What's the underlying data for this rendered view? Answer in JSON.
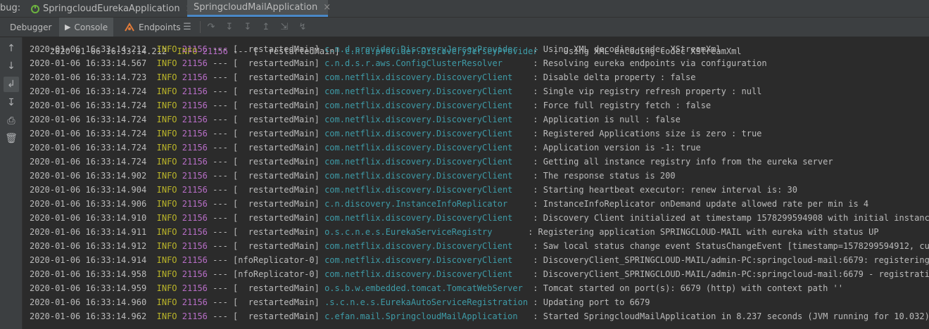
{
  "tabbar": {
    "label": "bug:",
    "tabs": [
      {
        "label": "SpringcloudEurekaApplication",
        "close": "×",
        "active": false
      },
      {
        "label": "SpringcloudMailApplication",
        "close": "×",
        "active": true
      }
    ]
  },
  "toolbar": {
    "items": [
      {
        "label": "Debugger",
        "icon": ""
      },
      {
        "label": "Console",
        "icon": "console-icon"
      },
      {
        "label": "Endpoints",
        "icon": "endpoints-icon"
      }
    ]
  },
  "colors": {
    "background": "#2b2b2b",
    "timestamp": "#bbbbbb",
    "level": "#bbb529",
    "pid": "#b86ec7",
    "logger": "#3e9ba7",
    "active_tab_underline": "#4a88c7"
  },
  "console": {
    "partial_top_line": {
      "timestamp": "2020-01-06 16:33:14.212",
      "level": "INFO",
      "pid": "21156",
      "sep": "--- [",
      "thread": "  restartedMain]",
      "logger": "c.n.d.provider.DiscoveryJerseyProvider",
      "message": ": Using XML encoding codec XStreamXml"
    },
    "lines": [
      {
        "timestamp": "2020-01-06 16:33:14.212",
        "level": "INFO",
        "pid": "21156",
        "sep": "--- [",
        "thread": "  restartedMain]",
        "logger": "c.n.d.provider.DiscoveryJerseyProvider  ",
        "message": ": Using XML decoding codec XStreamXml"
      },
      {
        "timestamp": "2020-01-06 16:33:14.567",
        "level": "INFO",
        "pid": "21156",
        "sep": "--- [",
        "thread": "  restartedMain]",
        "logger": "c.n.d.s.r.aws.ConfigClusterResolver     ",
        "message": ": Resolving eureka endpoints via configuration"
      },
      {
        "timestamp": "2020-01-06 16:33:14.723",
        "level": "INFO",
        "pid": "21156",
        "sep": "--- [",
        "thread": "  restartedMain]",
        "logger": "com.netflix.discovery.DiscoveryClient   ",
        "message": ": Disable delta property : false"
      },
      {
        "timestamp": "2020-01-06 16:33:14.724",
        "level": "INFO",
        "pid": "21156",
        "sep": "--- [",
        "thread": "  restartedMain]",
        "logger": "com.netflix.discovery.DiscoveryClient   ",
        "message": ": Single vip registry refresh property : null"
      },
      {
        "timestamp": "2020-01-06 16:33:14.724",
        "level": "INFO",
        "pid": "21156",
        "sep": "--- [",
        "thread": "  restartedMain]",
        "logger": "com.netflix.discovery.DiscoveryClient   ",
        "message": ": Force full registry fetch : false"
      },
      {
        "timestamp": "2020-01-06 16:33:14.724",
        "level": "INFO",
        "pid": "21156",
        "sep": "--- [",
        "thread": "  restartedMain]",
        "logger": "com.netflix.discovery.DiscoveryClient   ",
        "message": ": Application is null : false"
      },
      {
        "timestamp": "2020-01-06 16:33:14.724",
        "level": "INFO",
        "pid": "21156",
        "sep": "--- [",
        "thread": "  restartedMain]",
        "logger": "com.netflix.discovery.DiscoveryClient   ",
        "message": ": Registered Applications size is zero : true"
      },
      {
        "timestamp": "2020-01-06 16:33:14.724",
        "level": "INFO",
        "pid": "21156",
        "sep": "--- [",
        "thread": "  restartedMain]",
        "logger": "com.netflix.discovery.DiscoveryClient   ",
        "message": ": Application version is -1: true"
      },
      {
        "timestamp": "2020-01-06 16:33:14.724",
        "level": "INFO",
        "pid": "21156",
        "sep": "--- [",
        "thread": "  restartedMain]",
        "logger": "com.netflix.discovery.DiscoveryClient   ",
        "message": ": Getting all instance registry info from the eureka server"
      },
      {
        "timestamp": "2020-01-06 16:33:14.902",
        "level": "INFO",
        "pid": "21156",
        "sep": "--- [",
        "thread": "  restartedMain]",
        "logger": "com.netflix.discovery.DiscoveryClient   ",
        "message": ": The response status is 200"
      },
      {
        "timestamp": "2020-01-06 16:33:14.904",
        "level": "INFO",
        "pid": "21156",
        "sep": "--- [",
        "thread": "  restartedMain]",
        "logger": "com.netflix.discovery.DiscoveryClient   ",
        "message": ": Starting heartbeat executor: renew interval is: 30"
      },
      {
        "timestamp": "2020-01-06 16:33:14.906",
        "level": "INFO",
        "pid": "21156",
        "sep": "--- [",
        "thread": "  restartedMain]",
        "logger": "c.n.discovery.InstanceInfoReplicator    ",
        "message": ": InstanceInfoReplicator onDemand update allowed rate per min is 4"
      },
      {
        "timestamp": "2020-01-06 16:33:14.910",
        "level": "INFO",
        "pid": "21156",
        "sep": "--- [",
        "thread": "  restartedMain]",
        "logger": "com.netflix.discovery.DiscoveryClient   ",
        "message": ": Discovery Client initialized at timestamp 1578299594908 with initial instances cou"
      },
      {
        "timestamp": "2020-01-06 16:33:14.911",
        "level": "INFO",
        "pid": "21156",
        "sep": "--- [",
        "thread": "  restartedMain]",
        "logger": "o.s.c.n.e.s.EurekaServiceRegistry      ",
        "message": ": Registering application SPRINGCLOUD-MAIL with eureka with status UP"
      },
      {
        "timestamp": "2020-01-06 16:33:14.912",
        "level": "INFO",
        "pid": "21156",
        "sep": "--- [",
        "thread": "  restartedMain]",
        "logger": "com.netflix.discovery.DiscoveryClient   ",
        "message": ": Saw local status change event StatusChangeEvent [timestamp=1578299594912, current="
      },
      {
        "timestamp": "2020-01-06 16:33:14.914",
        "level": "INFO",
        "pid": "21156",
        "sep": "--- [",
        "thread": "nfoReplicator-0]",
        "logger": "com.netflix.discovery.DiscoveryClient   ",
        "message": ": DiscoveryClient_SPRINGCLOUD-MAIL/admin-PC:springcloud-mail:6679: registering servi"
      },
      {
        "timestamp": "2020-01-06 16:33:14.958",
        "level": "INFO",
        "pid": "21156",
        "sep": "--- [",
        "thread": "nfoReplicator-0]",
        "logger": "com.netflix.discovery.DiscoveryClient   ",
        "message": ": DiscoveryClient_SPRINGCLOUD-MAIL/admin-PC:springcloud-mail:6679 - registration sta"
      },
      {
        "timestamp": "2020-01-06 16:33:14.959",
        "level": "INFO",
        "pid": "21156",
        "sep": "--- [",
        "thread": "  restartedMain]",
        "logger": "o.s.b.w.embedded.tomcat.TomcatWebServer ",
        "message": ": Tomcat started on port(s): 6679 (http) with context path ''"
      },
      {
        "timestamp": "2020-01-06 16:33:14.960",
        "level": "INFO",
        "pid": "21156",
        "sep": "--- [",
        "thread": "  restartedMain]",
        "logger": ".s.c.n.e.s.EurekaAutoServiceRegistration",
        "message": ": Updating port to 6679"
      },
      {
        "timestamp": "2020-01-06 16:33:14.962",
        "level": "INFO",
        "pid": "21156",
        "sep": "--- [",
        "thread": "  restartedMain]",
        "logger": "c.efan.mail.SpringcloudMailApplication  ",
        "message": ": Started SpringcloudMailApplication in 8.237 seconds (JVM running for 10.032)"
      }
    ]
  }
}
